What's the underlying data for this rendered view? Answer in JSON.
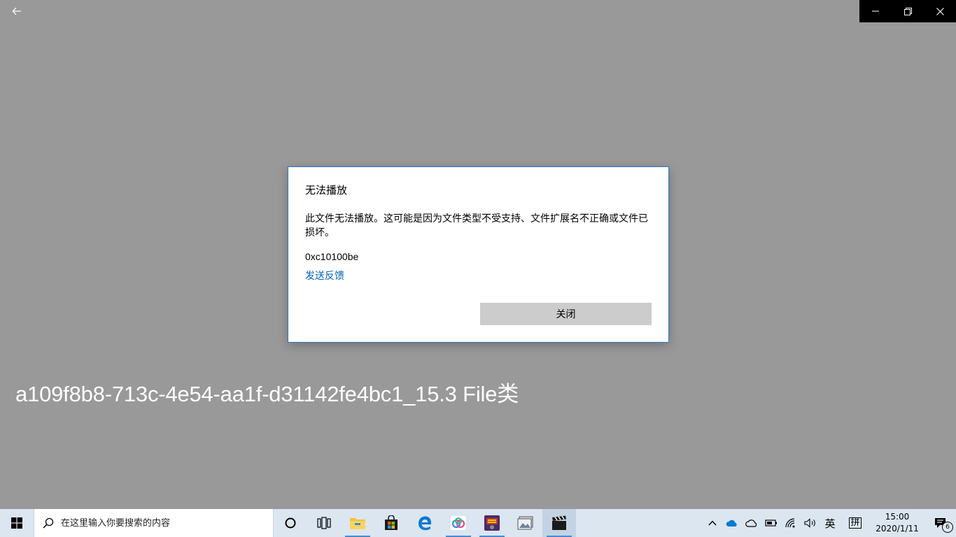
{
  "window": {
    "file_title": "a109f8b8-713c-4e54-aa1f-d31142fe4bc1_15.3 File类"
  },
  "dialog": {
    "title": "无法播放",
    "message": "此文件无法播放。这可能是因为文件类型不受支持、文件扩展名不正确或文件已损坏。",
    "error_code": "0xc10100be",
    "feedback_link": "发送反馈",
    "close_button": "关闭"
  },
  "taskbar": {
    "search_placeholder": "在这里输入你要搜索的内容",
    "apps": [
      "file-explorer",
      "microsoft-store",
      "edge",
      "baidu-netdisk",
      "game-app",
      "photos-app",
      "movies-tv"
    ]
  },
  "tray": {
    "ime_lang": "英",
    "ime_mode": "拼",
    "time": "15:00",
    "date": "2020/1/11",
    "notification_count": "6"
  },
  "colors": {
    "app_background": "#999999",
    "dialog_border": "#2b79c8",
    "link": "#0063b1",
    "button": "#cccccc",
    "taskbar": "#dbe6f1"
  }
}
